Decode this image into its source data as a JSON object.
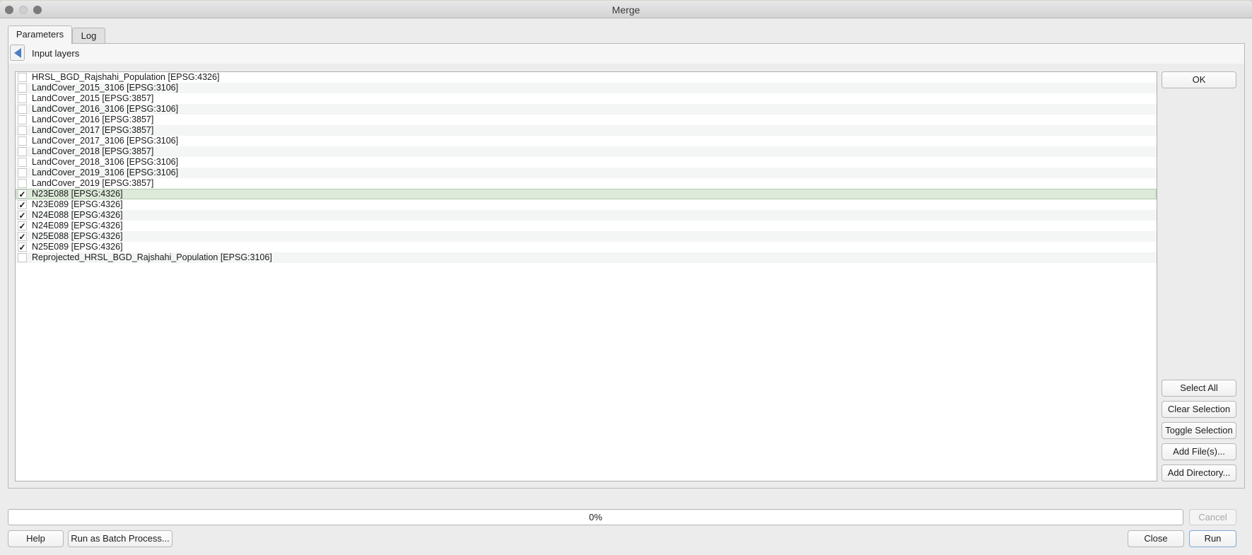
{
  "window": {
    "title": "Merge"
  },
  "tabs": [
    {
      "label": "Parameters",
      "active": true
    },
    {
      "label": "Log",
      "active": false
    }
  ],
  "section": {
    "title": "Input layers"
  },
  "layers": [
    {
      "label": "HRSL_BGD_Rajshahi_Population [EPSG:4326]",
      "checked": false,
      "selected": false
    },
    {
      "label": "LandCover_2015_3106 [EPSG:3106]",
      "checked": false,
      "selected": false
    },
    {
      "label": "LandCover_2015 [EPSG:3857]",
      "checked": false,
      "selected": false
    },
    {
      "label": "LandCover_2016_3106 [EPSG:3106]",
      "checked": false,
      "selected": false
    },
    {
      "label": "LandCover_2016 [EPSG:3857]",
      "checked": false,
      "selected": false
    },
    {
      "label": "LandCover_2017 [EPSG:3857]",
      "checked": false,
      "selected": false
    },
    {
      "label": "LandCover_2017_3106 [EPSG:3106]",
      "checked": false,
      "selected": false
    },
    {
      "label": "LandCover_2018 [EPSG:3857]",
      "checked": false,
      "selected": false
    },
    {
      "label": "LandCover_2018_3106 [EPSG:3106]",
      "checked": false,
      "selected": false
    },
    {
      "label": "LandCover_2019_3106 [EPSG:3106]",
      "checked": false,
      "selected": false
    },
    {
      "label": "LandCover_2019 [EPSG:3857]",
      "checked": false,
      "selected": false
    },
    {
      "label": "N23E088 [EPSG:4326]",
      "checked": true,
      "selected": true
    },
    {
      "label": "N23E089 [EPSG:4326]",
      "checked": true,
      "selected": false
    },
    {
      "label": "N24E088 [EPSG:4326]",
      "checked": true,
      "selected": false
    },
    {
      "label": "N24E089 [EPSG:4326]",
      "checked": true,
      "selected": false
    },
    {
      "label": "N25E088 [EPSG:4326]",
      "checked": true,
      "selected": false
    },
    {
      "label": "N25E089 [EPSG:4326]",
      "checked": true,
      "selected": false
    },
    {
      "label": "Reprojected_HRSL_BGD_Rajshahi_Population [EPSG:3106]",
      "checked": false,
      "selected": false
    }
  ],
  "check_glyph": "✓",
  "side_buttons": {
    "ok": "OK",
    "select_all": "Select All",
    "clear_selection": "Clear Selection",
    "toggle_selection": "Toggle Selection",
    "add_files": "Add File(s)...",
    "add_directory": "Add Directory..."
  },
  "progress": {
    "value_percent": 0,
    "text": "0%"
  },
  "footer": {
    "help": "Help",
    "batch": "Run as Batch Process...",
    "cancel": "Cancel",
    "close": "Close",
    "run": "Run"
  },
  "colors": {
    "selected_row": "#dde9d9",
    "back_arrow": "#4a7fc0",
    "default_button_border": "#7fa8d8"
  }
}
